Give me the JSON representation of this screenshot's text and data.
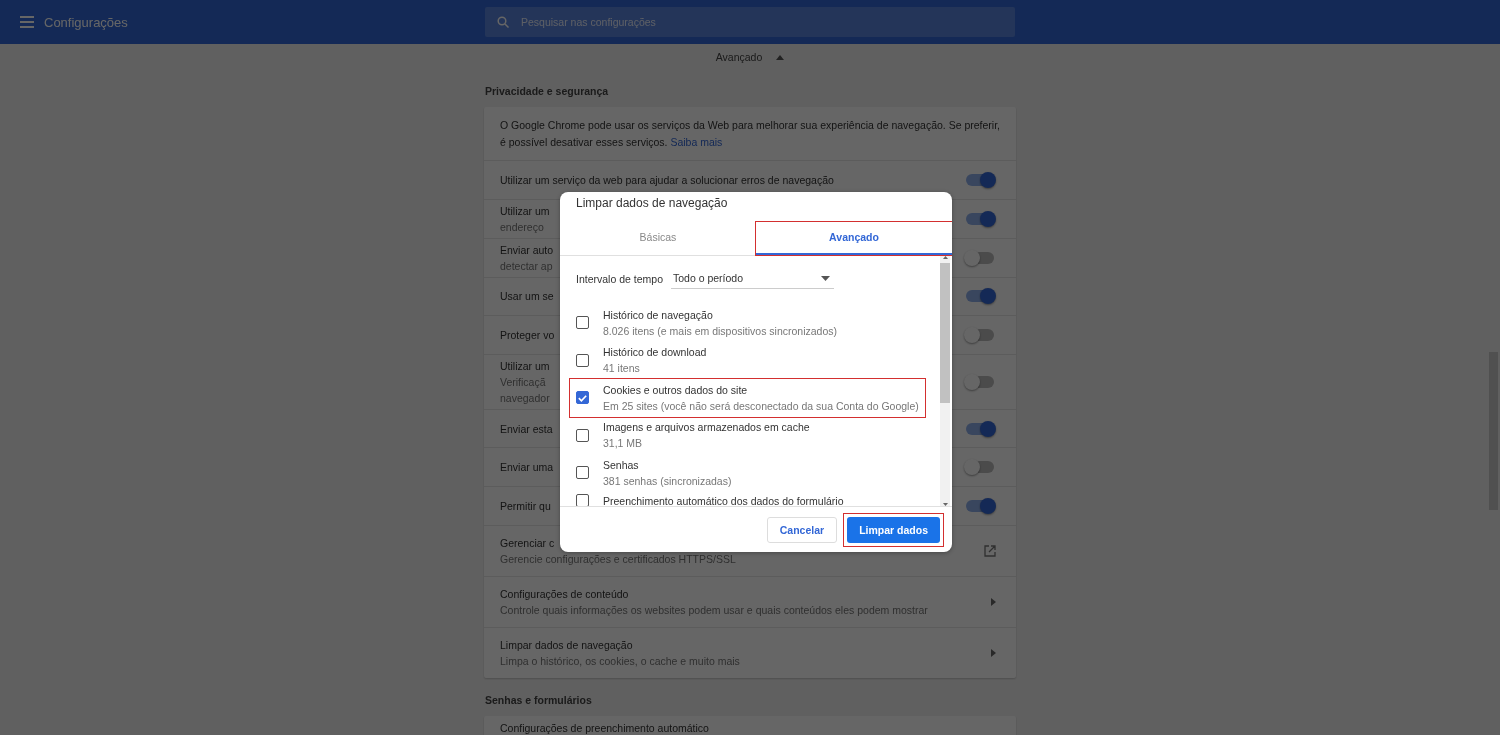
{
  "header": {
    "title": "Configurações",
    "search": {
      "placeholder": "Pesquisar nas configurações"
    }
  },
  "advanced_toggle": {
    "label": "Avançado",
    "expanded": true
  },
  "sections": [
    {
      "heading": "Privacidade e segurança",
      "intro": {
        "text": "O Google Chrome pode usar os serviços da Web para melhorar sua experiência de navegação. Se preferir, é possível desativar esses serviços.",
        "link": "Saiba mais"
      },
      "rows": [
        {
          "kind": "toggle",
          "lines": [
            "Utilizar um serviço da web para ajudar a solucionar erros de navegação"
          ],
          "on": true
        },
        {
          "kind": "toggle",
          "lines": [
            "Utilizar um",
            "endereço"
          ],
          "on": true
        },
        {
          "kind": "toggle",
          "lines": [
            "Enviar auto",
            "detectar ap"
          ],
          "on": false
        },
        {
          "kind": "toggle",
          "lines": [
            "Usar um se"
          ],
          "on": true
        },
        {
          "kind": "toggle",
          "lines": [
            "Proteger vo"
          ],
          "on": false
        },
        {
          "kind": "toggle",
          "lines": [
            "Utilizar um",
            "Verificaçã",
            "navegador"
          ],
          "on": false
        },
        {
          "kind": "toggle",
          "lines": [
            "Enviar esta"
          ],
          "on": true
        },
        {
          "kind": "toggle",
          "lines": [
            "Enviar uma"
          ],
          "on": false
        },
        {
          "kind": "toggle",
          "lines": [
            "Permitir qu"
          ],
          "on": true
        },
        {
          "kind": "external",
          "lines": [
            "Gerenciar c",
            "Gerencie configurações e certificados HTTPS/SSL"
          ]
        },
        {
          "kind": "arrow",
          "lines": [
            "Configurações de conteúdo",
            "Controle quais informações os websites podem usar e quais conteúdos eles podem mostrar"
          ]
        },
        {
          "kind": "arrow",
          "lines": [
            "Limpar dados de navegação",
            "Limpa o histórico, os cookies, o cache e muito mais"
          ]
        }
      ]
    },
    {
      "heading": "Senhas e formulários",
      "rows": [
        {
          "kind": "plain",
          "lines": [
            "Configurações de preenchimento automático"
          ]
        }
      ]
    }
  ],
  "dialog": {
    "title": "Limpar dados de navegação",
    "tabs": [
      {
        "label": "Básicas",
        "selected": false,
        "highlighted": false
      },
      {
        "label": "Avançado",
        "selected": true,
        "highlighted": true
      }
    ],
    "time_range": {
      "label": "Intervalo de tempo",
      "value": "Todo o período"
    },
    "items": [
      {
        "title": "Histórico de navegação",
        "detail": "8.026 itens (e mais em dispositivos sincronizados)",
        "checked": false,
        "highlighted": false
      },
      {
        "title": "Histórico de download",
        "detail": "41 itens",
        "checked": false,
        "highlighted": false
      },
      {
        "title": "Cookies e outros dados do site",
        "detail": "Em 25 sites (você não será desconectado da sua Conta do Google)",
        "checked": true,
        "highlighted": true
      },
      {
        "title": "Imagens e arquivos armazenados em cache",
        "detail": "31,1 MB",
        "checked": false,
        "highlighted": false
      },
      {
        "title": "Senhas",
        "detail": "381 senhas (sincronizadas)",
        "checked": false,
        "highlighted": false
      },
      {
        "title": "Preenchimento automático dos dados do formulário",
        "checked": false,
        "highlighted": false
      }
    ],
    "buttons": [
      {
        "label": "Cancelar",
        "kind": "secondary",
        "highlighted": false
      },
      {
        "label": "Limpar dados",
        "kind": "primary",
        "highlighted": true
      }
    ]
  }
}
